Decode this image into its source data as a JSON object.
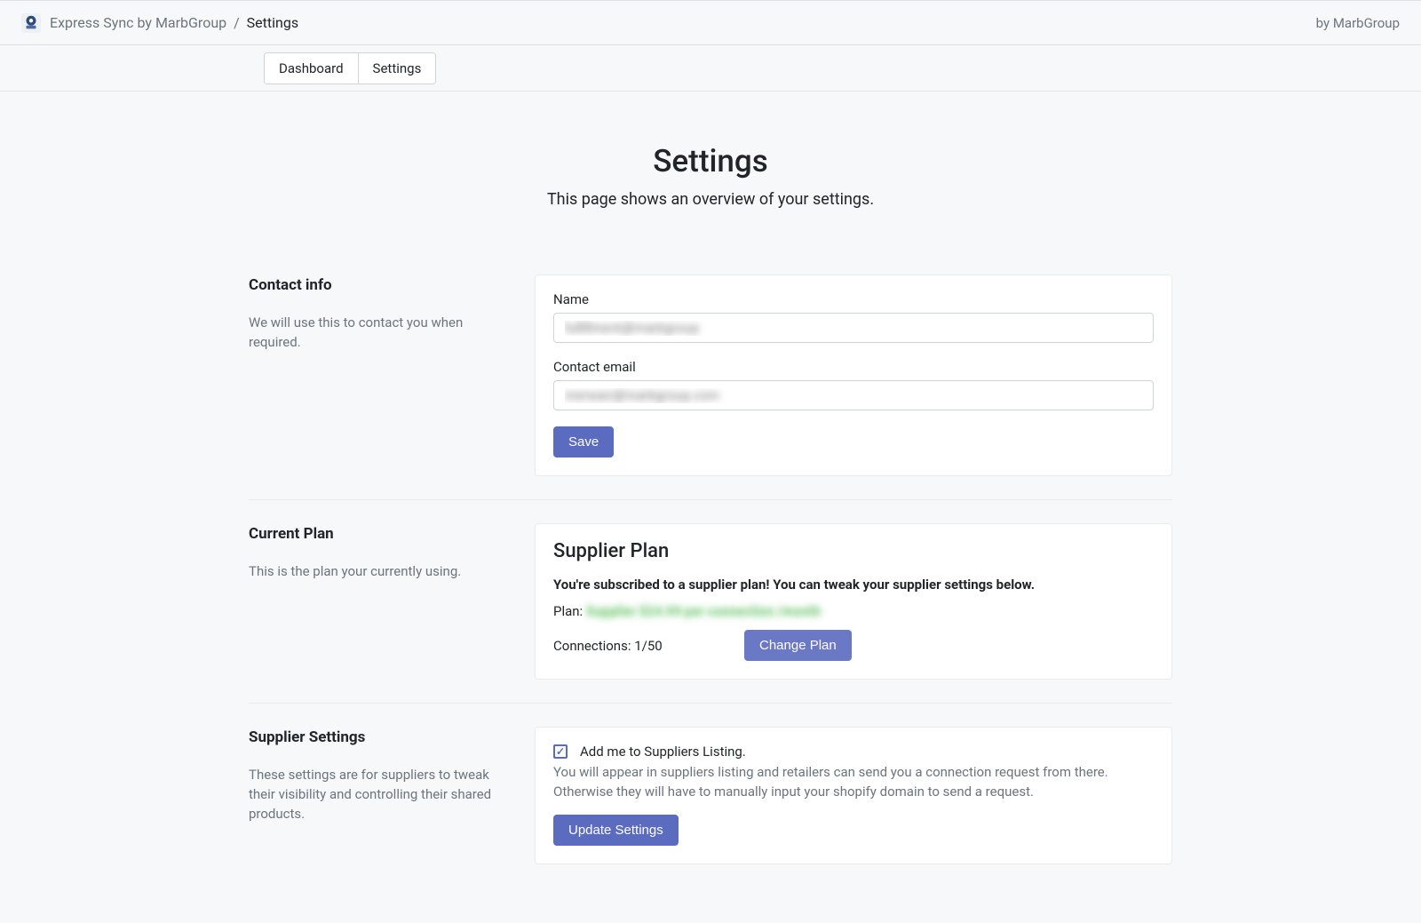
{
  "topbar": {
    "app_name": "Express Sync by MarbGroup",
    "breadcrumb_sep": "/",
    "current_page": "Settings",
    "byline": "by MarbGroup"
  },
  "tabs": {
    "dashboard": "Dashboard",
    "settings": "Settings"
  },
  "page": {
    "title": "Settings",
    "subtitle": "This page shows an overview of your settings."
  },
  "contact": {
    "heading": "Contact info",
    "desc": "We will use this to contact you when required.",
    "name_label": "Name",
    "name_value": "fulfillment@marbgroup",
    "email_label": "Contact email",
    "email_value": "merwan@marbgroup.com",
    "save": "Save"
  },
  "plan": {
    "heading": "Current Plan",
    "desc": "This is the plan your currently using.",
    "title": "Supplier Plan",
    "subscribed": "You're subscribed to a supplier plan! You can tweak your supplier settings below.",
    "plan_label": "Plan:",
    "plan_value": "Supplier $24.99 per connection /month",
    "connections_label": "Connections:",
    "connections_value": "1/50",
    "change": "Change Plan"
  },
  "supplier": {
    "heading": "Supplier Settings",
    "desc": "These settings are for suppliers to tweak their visibility and controlling their shared products.",
    "chk_label": "Add me to Suppliers Listing.",
    "chk_help": "You will appear in suppliers listing and retailers can send you a connection request from there. Otherwise they will have to manually input your shopify domain to send a request.",
    "update": "Update Settings"
  }
}
